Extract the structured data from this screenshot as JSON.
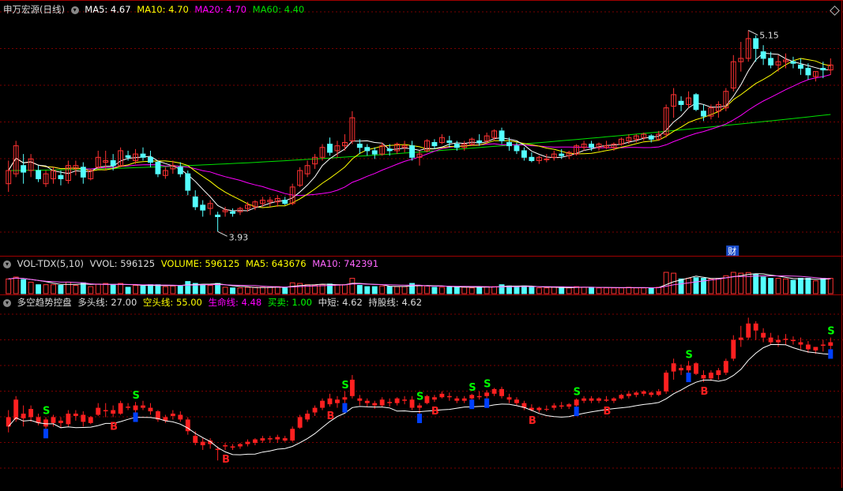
{
  "colors": {
    "up": "#ff3232",
    "down": "#54ffff",
    "ma5": "#ffffff",
    "ma10": "#ffff00",
    "ma20": "#ff00ff",
    "ma60": "#00e000",
    "grid": "#7a0000",
    "border": "#a00000",
    "lower_up": "#ff2020",
    "lower_line": "#ffffff",
    "buy": "#ff2020",
    "sell": "#00ff00",
    "sell_bar": "#0040ff",
    "vol_ma10": "#ff66ff"
  },
  "main_panel": {
    "title": "申万宏源(日线)",
    "indicator_icon": "chevron-down-icon",
    "ma5_label": "MA5: 4.67",
    "ma10_label": "MA10: 4.70",
    "ma20_label": "MA20: 4.70",
    "ma60_label": "MA60: 4.40",
    "high_label": "5.15",
    "low_label": "3.93",
    "fin_marker": "财"
  },
  "volume_panel": {
    "name": "VOL-TDX(5,10)",
    "vvol": "VVOL: 596125",
    "volume": "VOLUME: 596125",
    "ma5": "MA5: 643676",
    "ma10": "MA10: 742391"
  },
  "lower_panel": {
    "name": "多空趋势控盘",
    "bull": "多头线: 27.00",
    "bear": "空头线: 55.00",
    "life": "生命线: 4.48",
    "trade": "买卖: 1.00",
    "mid": "中短: 4.62",
    "hold": "持股线: 4.62",
    "buy_letter": "B",
    "sell_letter": "S"
  },
  "chart_data": {
    "type": "candlestick",
    "y_range": [
      3.85,
      5.2
    ],
    "ohlc": [
      [
        4.22,
        4.36,
        4.17,
        4.3
      ],
      [
        4.28,
        4.48,
        4.26,
        4.45
      ],
      [
        4.33,
        4.4,
        4.22,
        4.29
      ],
      [
        4.3,
        4.4,
        4.26,
        4.37
      ],
      [
        4.3,
        4.33,
        4.23,
        4.25
      ],
      [
        4.22,
        4.3,
        4.2,
        4.28
      ],
      [
        4.25,
        4.32,
        4.22,
        4.3
      ],
      [
        4.27,
        4.3,
        4.21,
        4.25
      ],
      [
        4.24,
        4.36,
        4.22,
        4.33
      ],
      [
        4.31,
        4.36,
        4.27,
        4.33
      ],
      [
        4.32,
        4.35,
        4.22,
        4.26
      ],
      [
        4.25,
        4.31,
        4.24,
        4.3
      ],
      [
        4.32,
        4.42,
        4.31,
        4.38
      ],
      [
        4.35,
        4.42,
        4.3,
        4.36
      ],
      [
        4.36,
        4.4,
        4.3,
        4.33
      ],
      [
        4.33,
        4.44,
        4.32,
        4.42
      ],
      [
        4.39,
        4.42,
        4.36,
        4.38
      ],
      [
        4.36,
        4.43,
        4.34,
        4.4
      ],
      [
        4.4,
        4.44,
        4.36,
        4.38
      ],
      [
        4.38,
        4.42,
        4.32,
        4.35
      ],
      [
        4.35,
        4.36,
        4.26,
        4.28
      ],
      [
        4.27,
        4.32,
        4.25,
        4.3
      ],
      [
        4.31,
        4.36,
        4.28,
        4.33
      ],
      [
        4.32,
        4.35,
        4.26,
        4.28
      ],
      [
        4.28,
        4.3,
        4.15,
        4.18
      ],
      [
        4.14,
        4.18,
        4.06,
        4.08
      ],
      [
        4.09,
        4.12,
        4.02,
        4.06
      ],
      [
        4.07,
        4.12,
        4.03,
        4.1
      ],
      [
        4.03,
        4.05,
        3.93,
        4.02
      ],
      [
        4.05,
        4.08,
        4.02,
        4.06
      ],
      [
        4.05,
        4.07,
        4.02,
        4.04
      ],
      [
        4.05,
        4.08,
        4.03,
        4.07
      ],
      [
        4.07,
        4.11,
        4.05,
        4.09
      ],
      [
        4.08,
        4.12,
        4.06,
        4.11
      ],
      [
        4.1,
        4.14,
        4.08,
        4.12
      ],
      [
        4.11,
        4.14,
        4.08,
        4.12
      ],
      [
        4.11,
        4.15,
        4.08,
        4.13
      ],
      [
        4.12,
        4.14,
        4.09,
        4.1
      ],
      [
        4.1,
        4.22,
        4.09,
        4.2
      ],
      [
        4.21,
        4.32,
        4.2,
        4.3
      ],
      [
        4.28,
        4.36,
        4.26,
        4.33
      ],
      [
        4.34,
        4.4,
        4.31,
        4.38
      ],
      [
        4.38,
        4.46,
        4.36,
        4.44
      ],
      [
        4.46,
        4.5,
        4.39,
        4.41
      ],
      [
        4.42,
        4.48,
        4.38,
        4.45
      ],
      [
        4.45,
        4.52,
        4.42,
        4.47
      ],
      [
        4.48,
        4.66,
        4.46,
        4.62
      ],
      [
        4.46,
        4.49,
        4.4,
        4.44
      ],
      [
        4.44,
        4.46,
        4.39,
        4.42
      ],
      [
        4.42,
        4.44,
        4.37,
        4.4
      ],
      [
        4.4,
        4.47,
        4.39,
        4.45
      ],
      [
        4.43,
        4.46,
        4.39,
        4.42
      ],
      [
        4.42,
        4.47,
        4.4,
        4.46
      ],
      [
        4.44,
        4.48,
        4.41,
        4.45
      ],
      [
        4.45,
        4.48,
        4.36,
        4.38
      ],
      [
        4.38,
        4.42,
        4.33,
        4.4
      ],
      [
        4.42,
        4.49,
        4.41,
        4.48
      ],
      [
        4.47,
        4.49,
        4.43,
        4.45
      ],
      [
        4.47,
        4.52,
        4.46,
        4.5
      ],
      [
        4.48,
        4.51,
        4.44,
        4.47
      ],
      [
        4.46,
        4.48,
        4.42,
        4.44
      ],
      [
        4.44,
        4.48,
        4.42,
        4.46
      ],
      [
        4.46,
        4.5,
        4.45,
        4.49
      ],
      [
        4.48,
        4.52,
        4.45,
        4.47
      ],
      [
        4.48,
        4.53,
        4.46,
        4.51
      ],
      [
        4.5,
        4.55,
        4.48,
        4.54
      ],
      [
        4.54,
        4.56,
        4.46,
        4.48
      ],
      [
        4.47,
        4.5,
        4.42,
        4.45
      ],
      [
        4.45,
        4.47,
        4.4,
        4.42
      ],
      [
        4.42,
        4.44,
        4.36,
        4.38
      ],
      [
        4.38,
        4.41,
        4.35,
        4.36
      ],
      [
        4.36,
        4.39,
        4.34,
        4.38
      ],
      [
        4.37,
        4.4,
        4.35,
        4.37
      ],
      [
        4.38,
        4.42,
        4.36,
        4.4
      ],
      [
        4.4,
        4.43,
        4.37,
        4.39
      ],
      [
        4.39,
        4.42,
        4.37,
        4.41
      ],
      [
        4.4,
        4.46,
        4.39,
        4.45
      ],
      [
        4.44,
        4.48,
        4.42,
        4.46
      ],
      [
        4.46,
        4.48,
        4.42,
        4.44
      ],
      [
        4.44,
        4.47,
        4.42,
        4.46
      ],
      [
        4.44,
        4.48,
        4.43,
        4.45
      ],
      [
        4.44,
        4.47,
        4.42,
        4.46
      ],
      [
        4.46,
        4.5,
        4.45,
        4.49
      ],
      [
        4.48,
        4.52,
        4.46,
        4.5
      ],
      [
        4.49,
        4.52,
        4.47,
        4.51
      ],
      [
        4.5,
        4.53,
        4.48,
        4.52
      ],
      [
        4.51,
        4.52,
        4.47,
        4.49
      ],
      [
        4.49,
        4.54,
        4.48,
        4.52
      ],
      [
        4.52,
        4.7,
        4.5,
        4.68
      ],
      [
        4.69,
        4.8,
        4.62,
        4.76
      ],
      [
        4.72,
        4.75,
        4.66,
        4.7
      ],
      [
        4.7,
        4.78,
        4.68,
        4.74
      ],
      [
        4.76,
        4.77,
        4.66,
        4.67
      ],
      [
        4.66,
        4.7,
        4.6,
        4.63
      ],
      [
        4.63,
        4.7,
        4.61,
        4.68
      ],
      [
        4.66,
        4.72,
        4.62,
        4.7
      ],
      [
        4.68,
        4.8,
        4.66,
        4.78
      ],
      [
        4.8,
        5.0,
        4.78,
        4.96
      ],
      [
        4.96,
        5.08,
        4.9,
        4.98
      ],
      [
        4.98,
        5.15,
        4.96,
        5.1
      ],
      [
        5.1,
        5.12,
        4.96,
        5.04
      ],
      [
        5.02,
        5.06,
        4.94,
        4.98
      ],
      [
        4.98,
        5.02,
        4.92,
        4.94
      ],
      [
        4.94,
        5.0,
        4.9,
        4.96
      ],
      [
        4.96,
        5.01,
        4.92,
        4.97
      ],
      [
        4.96,
        4.99,
        4.92,
        4.95
      ],
      [
        4.94,
        4.98,
        4.88,
        4.92
      ],
      [
        4.92,
        4.95,
        4.85,
        4.88
      ],
      [
        4.87,
        4.9,
        4.84,
        4.9
      ],
      [
        4.92,
        4.96,
        4.86,
        4.91
      ],
      [
        4.91,
        4.98,
        4.88,
        4.94
      ]
    ],
    "ma60_start": 4.3,
    "ma60_end": 4.64,
    "signals_buy": [
      14,
      29,
      43,
      57,
      70,
      80,
      93
    ],
    "signals_sell": [
      5,
      17,
      45,
      55,
      62,
      64,
      76,
      91,
      110
    ]
  }
}
